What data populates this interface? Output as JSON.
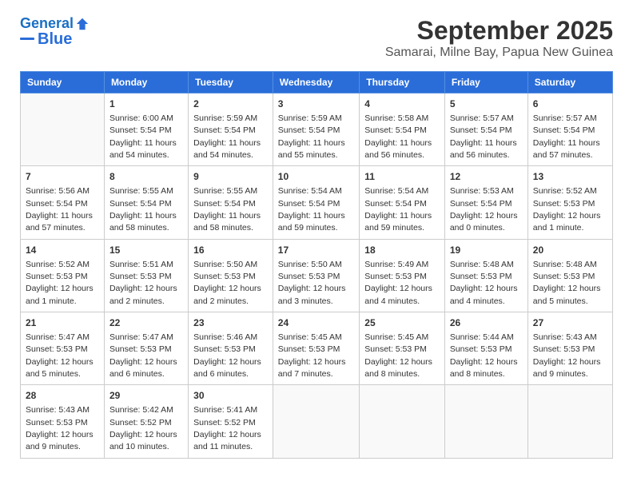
{
  "header": {
    "logo_line1": "General",
    "logo_line2": "Blue",
    "month_title": "September 2025",
    "subtitle": "Samarai, Milne Bay, Papua New Guinea"
  },
  "weekdays": [
    "Sunday",
    "Monday",
    "Tuesday",
    "Wednesday",
    "Thursday",
    "Friday",
    "Saturday"
  ],
  "weeks": [
    [
      {
        "day": "",
        "info": ""
      },
      {
        "day": "1",
        "info": "Sunrise: 6:00 AM\nSunset: 5:54 PM\nDaylight: 11 hours\nand 54 minutes."
      },
      {
        "day": "2",
        "info": "Sunrise: 5:59 AM\nSunset: 5:54 PM\nDaylight: 11 hours\nand 54 minutes."
      },
      {
        "day": "3",
        "info": "Sunrise: 5:59 AM\nSunset: 5:54 PM\nDaylight: 11 hours\nand 55 minutes."
      },
      {
        "day": "4",
        "info": "Sunrise: 5:58 AM\nSunset: 5:54 PM\nDaylight: 11 hours\nand 56 minutes."
      },
      {
        "day": "5",
        "info": "Sunrise: 5:57 AM\nSunset: 5:54 PM\nDaylight: 11 hours\nand 56 minutes."
      },
      {
        "day": "6",
        "info": "Sunrise: 5:57 AM\nSunset: 5:54 PM\nDaylight: 11 hours\nand 57 minutes."
      }
    ],
    [
      {
        "day": "7",
        "info": "Sunrise: 5:56 AM\nSunset: 5:54 PM\nDaylight: 11 hours\nand 57 minutes."
      },
      {
        "day": "8",
        "info": "Sunrise: 5:55 AM\nSunset: 5:54 PM\nDaylight: 11 hours\nand 58 minutes."
      },
      {
        "day": "9",
        "info": "Sunrise: 5:55 AM\nSunset: 5:54 PM\nDaylight: 11 hours\nand 58 minutes."
      },
      {
        "day": "10",
        "info": "Sunrise: 5:54 AM\nSunset: 5:54 PM\nDaylight: 11 hours\nand 59 minutes."
      },
      {
        "day": "11",
        "info": "Sunrise: 5:54 AM\nSunset: 5:54 PM\nDaylight: 11 hours\nand 59 minutes."
      },
      {
        "day": "12",
        "info": "Sunrise: 5:53 AM\nSunset: 5:54 PM\nDaylight: 12 hours\nand 0 minutes."
      },
      {
        "day": "13",
        "info": "Sunrise: 5:52 AM\nSunset: 5:53 PM\nDaylight: 12 hours\nand 1 minute."
      }
    ],
    [
      {
        "day": "14",
        "info": "Sunrise: 5:52 AM\nSunset: 5:53 PM\nDaylight: 12 hours\nand 1 minute."
      },
      {
        "day": "15",
        "info": "Sunrise: 5:51 AM\nSunset: 5:53 PM\nDaylight: 12 hours\nand 2 minutes."
      },
      {
        "day": "16",
        "info": "Sunrise: 5:50 AM\nSunset: 5:53 PM\nDaylight: 12 hours\nand 2 minutes."
      },
      {
        "day": "17",
        "info": "Sunrise: 5:50 AM\nSunset: 5:53 PM\nDaylight: 12 hours\nand 3 minutes."
      },
      {
        "day": "18",
        "info": "Sunrise: 5:49 AM\nSunset: 5:53 PM\nDaylight: 12 hours\nand 4 minutes."
      },
      {
        "day": "19",
        "info": "Sunrise: 5:48 AM\nSunset: 5:53 PM\nDaylight: 12 hours\nand 4 minutes."
      },
      {
        "day": "20",
        "info": "Sunrise: 5:48 AM\nSunset: 5:53 PM\nDaylight: 12 hours\nand 5 minutes."
      }
    ],
    [
      {
        "day": "21",
        "info": "Sunrise: 5:47 AM\nSunset: 5:53 PM\nDaylight: 12 hours\nand 5 minutes."
      },
      {
        "day": "22",
        "info": "Sunrise: 5:47 AM\nSunset: 5:53 PM\nDaylight: 12 hours\nand 6 minutes."
      },
      {
        "day": "23",
        "info": "Sunrise: 5:46 AM\nSunset: 5:53 PM\nDaylight: 12 hours\nand 6 minutes."
      },
      {
        "day": "24",
        "info": "Sunrise: 5:45 AM\nSunset: 5:53 PM\nDaylight: 12 hours\nand 7 minutes."
      },
      {
        "day": "25",
        "info": "Sunrise: 5:45 AM\nSunset: 5:53 PM\nDaylight: 12 hours\nand 8 minutes."
      },
      {
        "day": "26",
        "info": "Sunrise: 5:44 AM\nSunset: 5:53 PM\nDaylight: 12 hours\nand 8 minutes."
      },
      {
        "day": "27",
        "info": "Sunrise: 5:43 AM\nSunset: 5:53 PM\nDaylight: 12 hours\nand 9 minutes."
      }
    ],
    [
      {
        "day": "28",
        "info": "Sunrise: 5:43 AM\nSunset: 5:53 PM\nDaylight: 12 hours\nand 9 minutes."
      },
      {
        "day": "29",
        "info": "Sunrise: 5:42 AM\nSunset: 5:52 PM\nDaylight: 12 hours\nand 10 minutes."
      },
      {
        "day": "30",
        "info": "Sunrise: 5:41 AM\nSunset: 5:52 PM\nDaylight: 12 hours\nand 11 minutes."
      },
      {
        "day": "",
        "info": ""
      },
      {
        "day": "",
        "info": ""
      },
      {
        "day": "",
        "info": ""
      },
      {
        "day": "",
        "info": ""
      }
    ]
  ]
}
